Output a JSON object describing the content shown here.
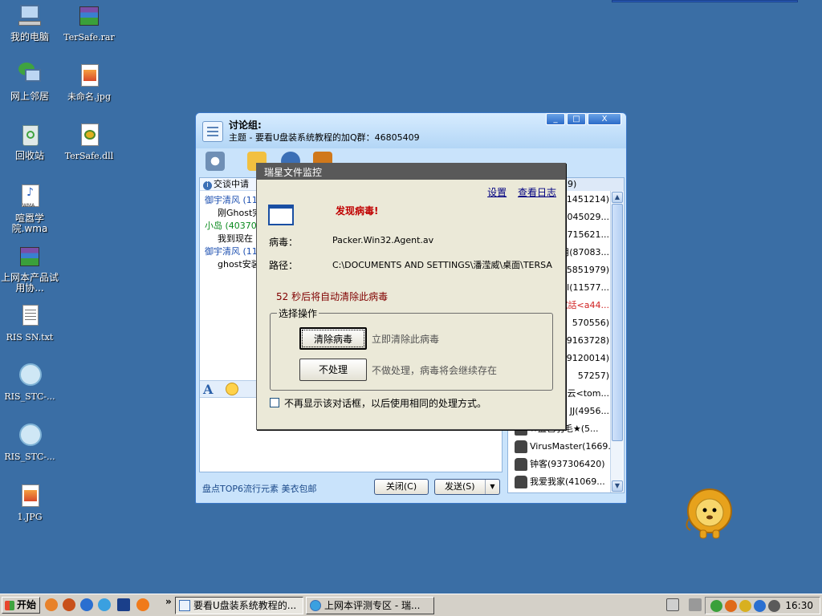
{
  "desktop": {
    "icons": [
      {
        "label": "我的电脑"
      },
      {
        "label": "TerSafe.rar"
      },
      {
        "label": "网上邻居"
      },
      {
        "label": "未命名.jpg"
      },
      {
        "label": "回收站"
      },
      {
        "label": "TerSafe.dll"
      },
      {
        "label": "喧嚣学院.wma"
      },
      {
        "label": "上网本产品试用协..."
      },
      {
        "label": "RIS SN.txt"
      },
      {
        "label": "RIS_STC-..."
      },
      {
        "label": "RIS_STC-..."
      },
      {
        "label": "1.JPG"
      }
    ]
  },
  "chat": {
    "title": "讨论组:",
    "subtitle": "主题 - 要看U盘装系统教程的加Q群：46805409",
    "window_buttons": [
      "_",
      "□",
      "X"
    ],
    "notice": "交谈中请",
    "messages": [
      {
        "name": "御宇清风 (11!",
        "text": "刚Ghost完"
      },
      {
        "name": "小岛 (403705",
        "text": "我到现在"
      },
      {
        "name": "御宇清风 (11!",
        "text": "ghost安装"
      }
    ],
    "ad_text": "盘点TOP6流行元素 美衣包邮",
    "close_button": "关闭(C)",
    "send_button": "发送(S)",
    "member_header": "9)",
    "members": [
      {
        "text": "(1451214)"
      },
      {
        "text": "1045029..."
      },
      {
        "text": "2715621..."
      },
      {
        "text": "用(87083..."
      },
      {
        "text": "5851979)"
      },
      {
        "text": "l(11577..."
      },
      {
        "text": "試話<a44...",
        "red": true
      },
      {
        "text": "570556)"
      },
      {
        "text": "59163728)"
      },
      {
        "text": "89120014)"
      },
      {
        "text": "57257)"
      },
      {
        "text": "i云<tom..."
      },
      {
        "text": "JJ(4956..."
      },
      {
        "text": "★蓝色羽毛★(5..."
      },
      {
        "text": "VirusMaster(1669..."
      },
      {
        "text": "钟客(937306420)"
      },
      {
        "text": "我爱我家(41069..."
      }
    ]
  },
  "dialog": {
    "title": "瑞星文件监控",
    "link_settings": "设置",
    "link_log": "查看日志",
    "found": "发现病毒!",
    "virus_label": "病毒：",
    "virus_value": "Packer.Win32.Agent.av",
    "path_label": "路径：",
    "path_value": "C:\\DOCUMENTS AND SETTINGS\\潘滢威\\桌面\\TERSA",
    "countdown": "52 秒后将自动清除此病毒",
    "group_label": "选择操作",
    "clean_button": "清除病毒",
    "clean_desc": "立即清除此病毒",
    "ignore_button": "不处理",
    "ignore_desc": "不做处理，病毒将会继续存在",
    "checkbox_label": "不再显示该对话框，以后使用相同的处理方式。"
  },
  "taskbar": {
    "start_label": "开始",
    "chevron": "»",
    "tasks": [
      {
        "label": "要看U盘装系统教程的..."
      },
      {
        "label": "上网本评测专区 - 瑞..."
      }
    ],
    "clock": "16:30"
  }
}
